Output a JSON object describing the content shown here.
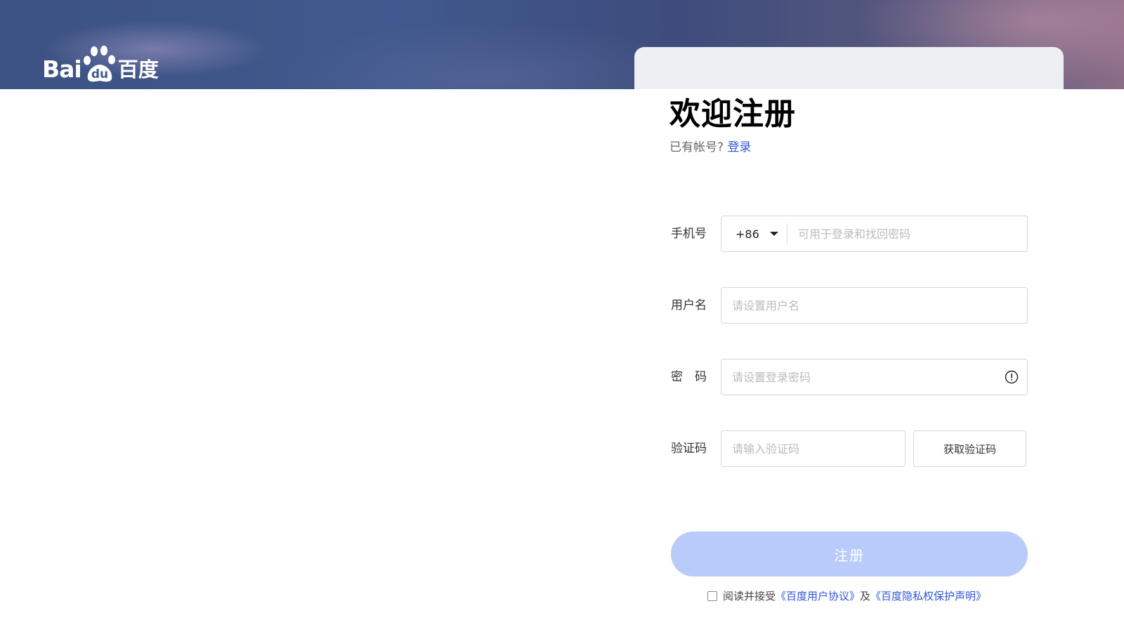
{
  "brand": {
    "logo_latin": "Bai",
    "logo_paw_text": "du",
    "logo_cn": "百度"
  },
  "register": {
    "title": "欢迎注册",
    "has_account_text": "已有帐号?",
    "login_link": "登录"
  },
  "form": {
    "phone": {
      "label": "手机号",
      "country_code": "+86",
      "placeholder": "可用于登录和找回密码"
    },
    "username": {
      "label": "用户名",
      "placeholder": "请设置用户名"
    },
    "password": {
      "label": "密　码",
      "placeholder": "请设置登录密码"
    },
    "verify": {
      "label": "验证码",
      "placeholder": "请输入验证码",
      "button": "获取验证码"
    },
    "submit": "注册"
  },
  "agreement": {
    "prefix": "阅读并接受",
    "user_agreement": "《百度用户协议》",
    "joiner": "及",
    "privacy": "《百度隐私权保护声明》"
  },
  "colors": {
    "link": "#3056d6",
    "submit_bg": "#b9cbfb",
    "banner": "#41598e"
  }
}
